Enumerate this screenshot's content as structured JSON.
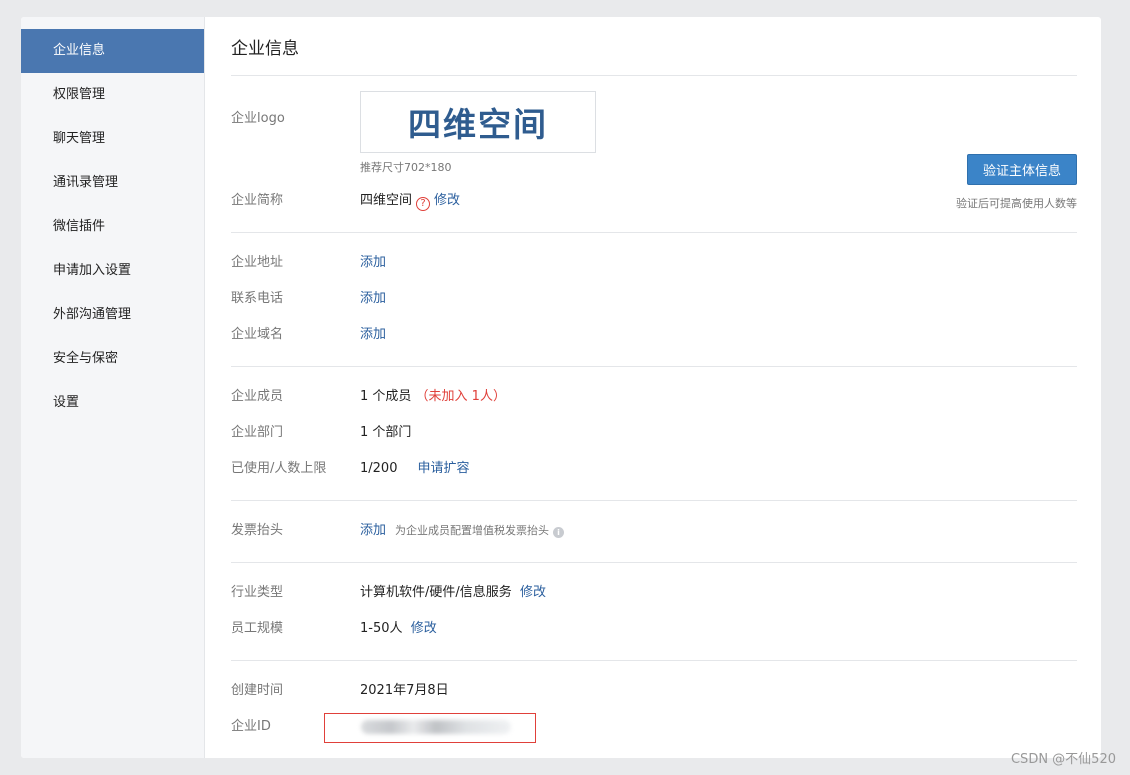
{
  "sidebar": {
    "items": [
      {
        "label": "企业信息",
        "active": true
      },
      {
        "label": "权限管理"
      },
      {
        "label": "聊天管理"
      },
      {
        "label": "通讯录管理"
      },
      {
        "label": "微信插件"
      },
      {
        "label": "申请加入设置"
      },
      {
        "label": "外部沟通管理"
      },
      {
        "label": "安全与保密"
      },
      {
        "label": "设置"
      }
    ]
  },
  "page": {
    "title": "企业信息"
  },
  "logo": {
    "label": "企业logo",
    "text": "四维空间",
    "hint": "推荐尺寸702*180"
  },
  "verify": {
    "button": "验证主体信息",
    "hint": "验证后可提高使用人数等"
  },
  "short_name": {
    "label": "企业简称",
    "value": "四维空间",
    "help": "?",
    "edit": "修改"
  },
  "contact": {
    "address_label": "企业地址",
    "address_action": "添加",
    "phone_label": "联系电话",
    "phone_action": "添加",
    "domain_label": "企业域名",
    "domain_action": "添加"
  },
  "members": {
    "members_label": "企业成员",
    "members_value": "1 个成员",
    "members_pending": "（未加入 1人）",
    "dept_label": "企业部门",
    "dept_value": "1 个部门",
    "limit_label": "已使用/人数上限",
    "limit_value": "1/200",
    "limit_action": "申请扩容"
  },
  "invoice": {
    "label": "发票抬头",
    "action": "添加",
    "hint": "为企业成员配置增值税发票抬头",
    "info": "i"
  },
  "industry": {
    "type_label": "行业类型",
    "type_value": "计算机软件/硬件/信息服务",
    "type_edit": "修改",
    "scale_label": "员工规模",
    "scale_value": "1-50人",
    "scale_edit": "修改"
  },
  "meta": {
    "created_label": "创建时间",
    "created_value": "2021年7月8日",
    "id_label": "企业ID"
  },
  "watermark": "CSDN @不仙520",
  "colors": {
    "accent": "#4a77b0",
    "button": "#3b84c8",
    "link": "#2b5f9e",
    "warning": "#e0403a"
  }
}
